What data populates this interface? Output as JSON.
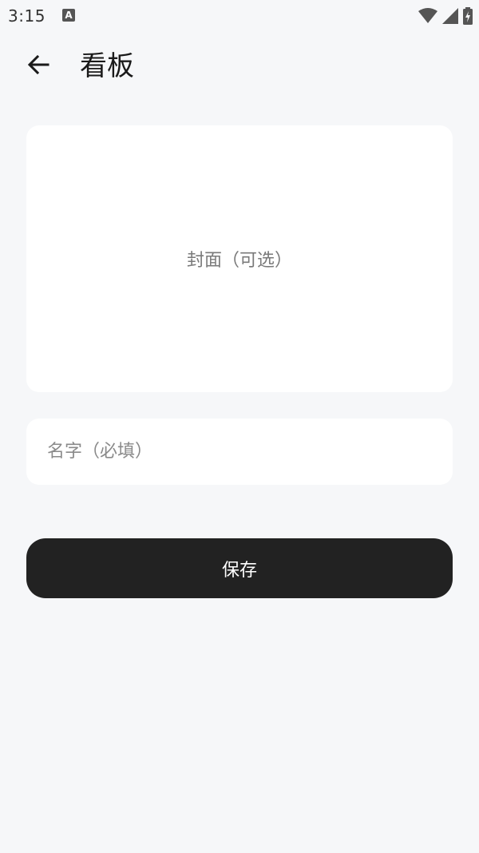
{
  "status_bar": {
    "time": "3:15",
    "app_icon": "A",
    "icons": [
      "wifi-icon",
      "signal-icon",
      "battery-charging-icon"
    ]
  },
  "header": {
    "back_icon": "arrow-left-icon",
    "title": "看板"
  },
  "cover": {
    "label": "封面（可选）"
  },
  "name_field": {
    "value": "",
    "placeholder": "名字（必填）"
  },
  "save_button": {
    "label": "保存"
  },
  "colors": {
    "background": "#f6f7f9",
    "card": "#ffffff",
    "primary_button": "#222222",
    "primary_button_text": "#ffffff",
    "placeholder_text": "#8a8a8a"
  }
}
